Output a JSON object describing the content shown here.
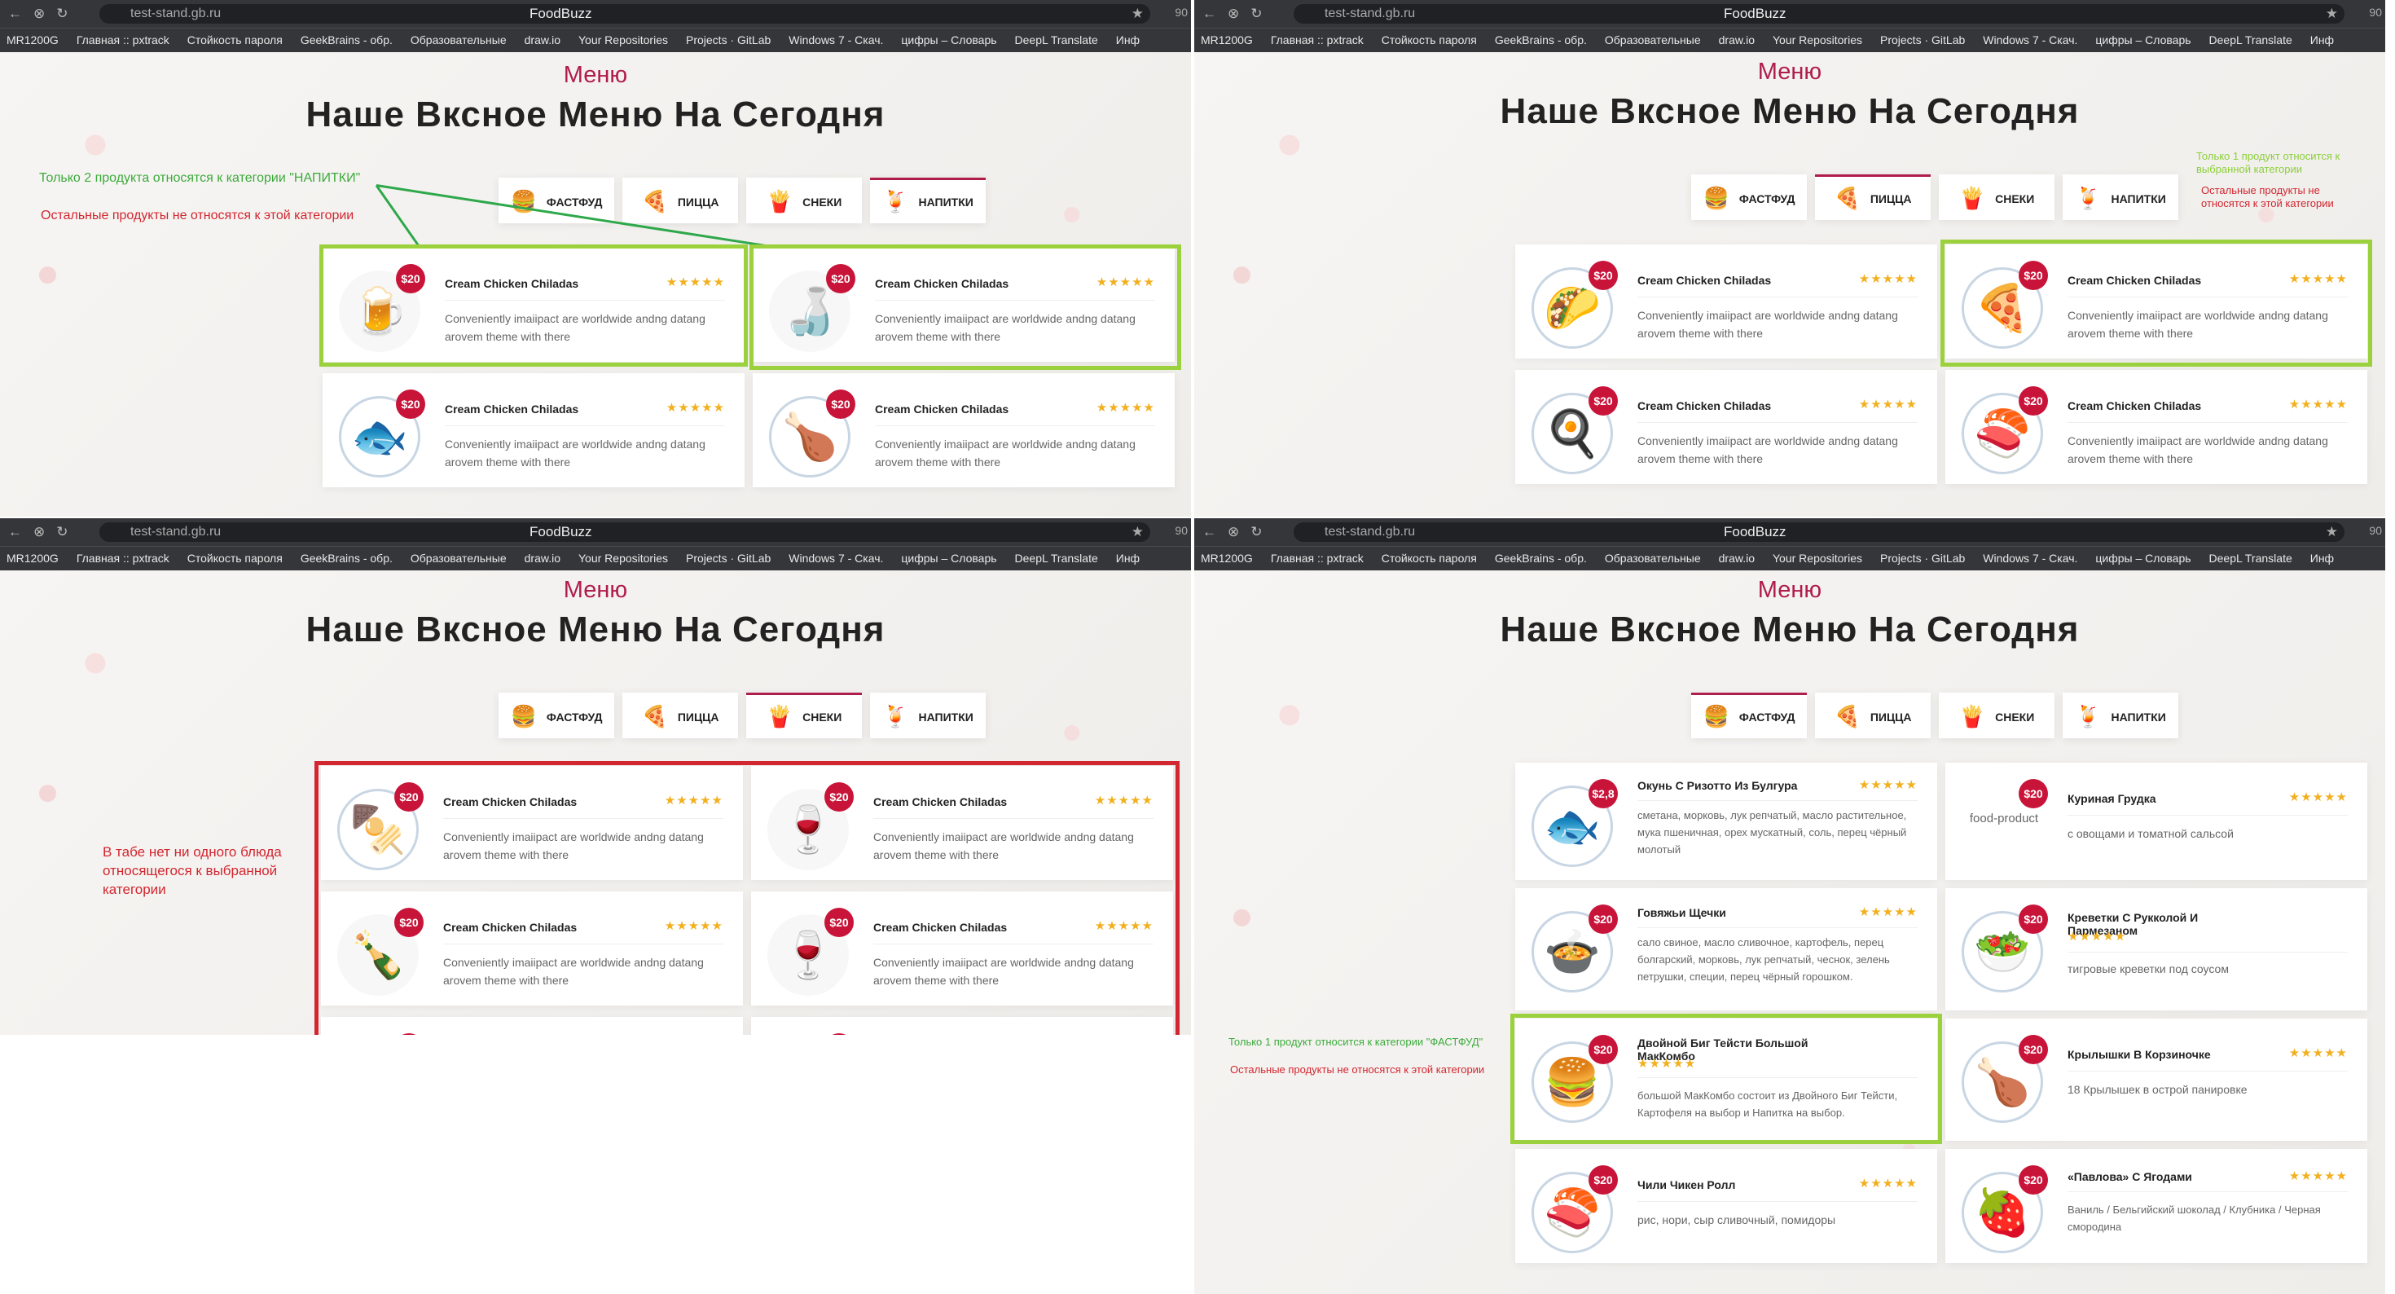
{
  "browser": {
    "url": "test-stand.gb.ru",
    "title": "FoodBuzz",
    "ext_badge": "90",
    "bookmarks": [
      "MR1200G",
      "Главная :: pxtrack",
      "Стойкость пароля",
      "GeekBrains - обр.",
      "Образовательные",
      "draw.io",
      "Your Repositories",
      "Projects · GitLab",
      "Windows 7 - Скач.",
      "цифры – Словарь",
      "DeepL Translate",
      "Инф"
    ]
  },
  "page": {
    "subtitle": "Меню",
    "title": "Наше Вксное Меню На Сегодня",
    "tabs": [
      {
        "label": "ФАСТФУД",
        "icon": "burger-icon"
      },
      {
        "label": "ПИЦЦА",
        "icon": "pizza-icon"
      },
      {
        "label": "СНЕКИ",
        "icon": "fries-icon"
      },
      {
        "label": "НАПИТКИ",
        "icon": "drinks-icon"
      }
    ]
  },
  "placeholder": {
    "name": "Cream Chicken Chiladas",
    "desc": "Conveniently imaiipact are worldwide andng datang arovem theme with there",
    "price": "$20",
    "stars": "★★★★★"
  },
  "q1": {
    "active_tab": "НАПИТКИ",
    "note_green": "Только 2 продукта относятся к категории \"НАПИТКИ\"",
    "note_red": "Остальные продукты не относятся к этой категории",
    "icons": [
      "beer-bottle-icon",
      "water-bottle-icon",
      "fish-dish-icon",
      "roast-chicken-icon"
    ]
  },
  "q2": {
    "active_tab": "ПИЦЦА",
    "note_green": "Только 1 продукт относится к выбранной категории",
    "note_red": "Остальные продукты не относятся к этой категории",
    "icons": [
      "taco-icon",
      "pizza-icon",
      "breakfast-icon",
      "salmon-icon"
    ]
  },
  "q3": {
    "active_tab": "СНЕКИ",
    "note_red": "В табе нет ни одного блюда относящегося к выбранной категории",
    "icons": [
      "kebab-icon",
      "wine-icon",
      "green-bottle-icon",
      "wine-glass-icon",
      "whiskey-icon",
      "brandy-icon"
    ]
  },
  "q4": {
    "active_tab": "ФАСТФУД",
    "note_green": "Только 1 продукт относится к категории \"ФАСТФУД\"",
    "note_red": "Остальные продукты не относятся к этой категории",
    "items": [
      {
        "name": "Окунь С Ризотто Из Булгура",
        "price": "$2,8",
        "desc": "сметана, морковь, лук репчатый, масло растительное, мука пшеничная, орех мускатный, соль, перец чёрный молотый",
        "icon": "fish-dish-icon"
      },
      {
        "name": "Куриная Грудка",
        "price": "$20",
        "desc": "с овощами и томатной сальсой",
        "broken": "food-product"
      },
      {
        "name": "Говяжьи Щечки",
        "price": "$20",
        "desc": "сало свиное, масло сливочное, картофель, перец болгарский, морковь, лук репчатый, чеснок, зелень петрушки, специи, перец чёрный горошком.",
        "icon": "meatballs-icon"
      },
      {
        "name": "Креветки С Рукколой И Пармезаном",
        "price": "$20",
        "desc": "тигровые креветки под соусом",
        "icon": "salad-icon"
      },
      {
        "name": "Двойной Биг Тейсти Большой МакКомбо",
        "price": "$20",
        "desc": "большой МакКомбо состоит из Двойного Биг Тейсти, Картофеля на выбор и Напитка на выбор.",
        "icon": "burger-combo-icon"
      },
      {
        "name": "Крылышки В Корзиночке",
        "price": "$20",
        "desc": "18 Крылышек в острой панировке",
        "icon": "wings-box-icon"
      },
      {
        "name": "Чили Чикен Ролл",
        "price": "$20",
        "desc": "рис, нори, сыр сливочный, помидоры",
        "icon": "sushi-roll-icon"
      },
      {
        "name": "«Павлова» С Ягодами",
        "price": "$20",
        "desc": "Ваниль / Бельгийский шоколад / Клубника / Черная смородина",
        "icon": "dessert-box-icon"
      }
    ]
  },
  "colors": {
    "accent": "#b01d4b",
    "price": "#c9143a",
    "star": "#f2b01e",
    "highlight_green": "#9bd13c",
    "highlight_red": "#d22630"
  }
}
